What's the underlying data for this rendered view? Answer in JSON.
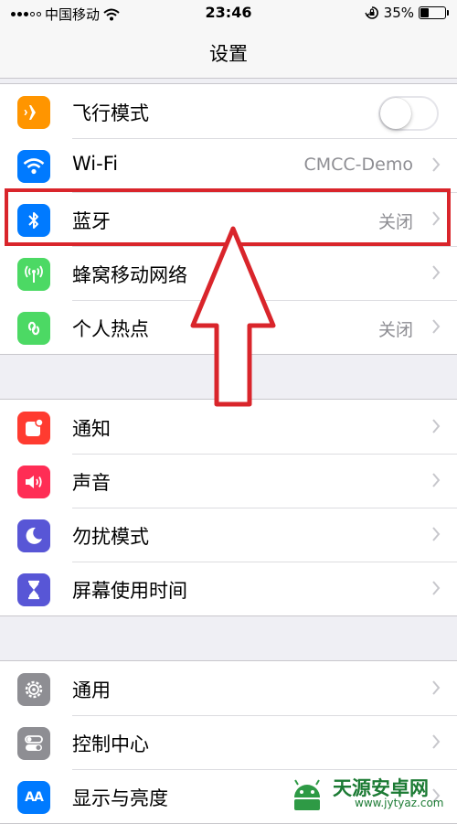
{
  "status": {
    "carrier": "中国移动",
    "time": "23:46",
    "battery_percent": "35%",
    "battery_level": 0.35
  },
  "nav": {
    "title": "设置"
  },
  "group1": [
    {
      "label": "飞行模式",
      "icon": "airplane-icon",
      "color": "#ff9500",
      "toggle_on": false
    },
    {
      "label": "Wi-Fi",
      "icon": "wifi-icon",
      "color": "#007aff",
      "value": "CMCC-Demo"
    },
    {
      "label": "蓝牙",
      "icon": "bluetooth-icon",
      "color": "#007aff",
      "value": "关闭"
    },
    {
      "label": "蜂窝移动网络",
      "icon": "antenna-icon",
      "color": "#4cd964",
      "value": ""
    },
    {
      "label": "个人热点",
      "icon": "hotspot-icon",
      "color": "#4cd964",
      "value": "关闭"
    }
  ],
  "group2": [
    {
      "label": "通知",
      "icon": "notification-icon",
      "color": "#ff3b30"
    },
    {
      "label": "声音",
      "icon": "speaker-icon",
      "color": "#ff2d55"
    },
    {
      "label": "勿扰模式",
      "icon": "moon-icon",
      "color": "#5856d6"
    },
    {
      "label": "屏幕使用时间",
      "icon": "hourglass-icon",
      "color": "#5856d6"
    }
  ],
  "group3": [
    {
      "label": "通用",
      "icon": "gear-icon",
      "color": "#8e8e93"
    },
    {
      "label": "控制中心",
      "icon": "switches-icon",
      "color": "#8e8e93"
    },
    {
      "label": "显示与亮度",
      "icon": "text-size-icon",
      "color": "#007aff",
      "icon_text": "AA"
    }
  ],
  "annotation": {
    "color": "#d9252b"
  },
  "watermark": {
    "text": "天源安卓网",
    "url": "www.jytyaz.com"
  }
}
